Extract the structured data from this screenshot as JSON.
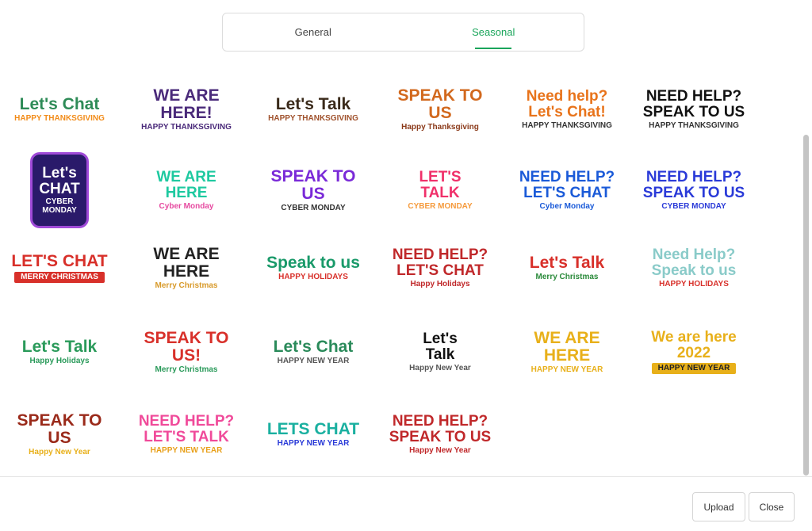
{
  "tabs": [
    {
      "label": "General"
    },
    {
      "label": "Seasonal"
    }
  ],
  "stickers": [
    {
      "l1": "Let's Chat",
      "l2": "",
      "l3": "HAPPY THANKSGIVING",
      "c1": "#2e8b57",
      "c3": "#f28c1a"
    },
    {
      "l1": "WE ARE HERE!",
      "l2": "",
      "l3": "HAPPY THANKSGIVING",
      "c1": "#4a2a7a",
      "c3": "#4a2a7a"
    },
    {
      "l1": "Let's Talk",
      "l2": "",
      "l3": "HAPPY THANKSGIVING",
      "c1": "#3a2a1a",
      "c3": "#a0522d"
    },
    {
      "l1": "SPEAK TO US",
      "l2": "",
      "l3": "Happy Thanksgiving",
      "c1": "#d2691e",
      "c3": "#8b3a1a"
    },
    {
      "l1": "Need help?",
      "l2": "Let's Chat!",
      "l3": "HAPPY THANKSGIVING",
      "c1": "#e8731a",
      "c3": "#333333"
    },
    {
      "l1": "NEED HELP?",
      "l2": "SPEAK TO US",
      "l3": "HAPPY THANKSGIVING",
      "c1": "#111111",
      "c3": "#333333"
    },
    {
      "l1": "Let's",
      "l2": "CHAT",
      "l3": "CYBER MONDAY",
      "c1": "#ffffff",
      "c3": "#ffffff"
    },
    {
      "l1": "WE ARE",
      "l2": "HERE",
      "l3": "Cyber Monday",
      "c1": "#1ec9a0",
      "c3": "#e64aa0"
    },
    {
      "l1": "SPEAK TO US",
      "l2": "",
      "l3": "CYBER MONDAY",
      "c1": "#7a2ad8",
      "c3": "#333333"
    },
    {
      "l1": "LET'S",
      "l2": "TALK",
      "l3": "CYBER MONDAY",
      "c1": "#f0306a",
      "c3": "#f59a3c"
    },
    {
      "l1": "NEED HELP?",
      "l2": "LET'S CHAT",
      "l3": "Cyber Monday",
      "c1": "#1a5ad8",
      "c3": "#1a5ad8"
    },
    {
      "l1": "NEED HELP?",
      "l2": "SPEAK TO US",
      "l3": "CYBER MONDAY",
      "c1": "#2a3ad8",
      "c3": "#2a3ad8"
    },
    {
      "l1": "LET'S CHAT",
      "l2": "",
      "l3": "MERRY CHRISTMAS",
      "c1": "#d8302a",
      "c3": "#ffffff"
    },
    {
      "l1": "WE ARE HERE",
      "l2": "",
      "l3": "Merry Christmas",
      "c1": "#222222",
      "c3": "#d89a2a"
    },
    {
      "l1": "Speak to us",
      "l2": "",
      "l3": "HAPPY HOLIDAYS",
      "c1": "#1a9a6a",
      "c3": "#d8302a"
    },
    {
      "l1": "NEED HELP?",
      "l2": "LET'S CHAT",
      "l3": "Happy Holidays",
      "c1": "#c0282a",
      "c3": "#c0282a"
    },
    {
      "l1": "Let's Talk",
      "l2": "",
      "l3": "Merry Christmas",
      "c1": "#d8302a",
      "c3": "#2a8a3a"
    },
    {
      "l1": "Need Help?",
      "l2": "Speak to us",
      "l3": "HAPPY HOLIDAYS",
      "c1": "#8acbc9",
      "c3": "#d8302a"
    },
    {
      "l1": "Let's Talk",
      "l2": "",
      "l3": "Happy Holidays",
      "c1": "#2a9a5a",
      "c3": "#2a9a5a"
    },
    {
      "l1": "SPEAK TO US!",
      "l2": "",
      "l3": "Merry Christmas",
      "c1": "#d8302a",
      "c3": "#2a9a5a"
    },
    {
      "l1": "Let's Chat",
      "l2": "",
      "l3": "HAPPY NEW YEAR",
      "c1": "#2a8a5a",
      "c3": "#555555"
    },
    {
      "l1": "Let's",
      "l2": "Talk",
      "l3": "Happy New Year",
      "c1": "#111111",
      "c3": "#555555"
    },
    {
      "l1": "WE ARE HERE",
      "l2": "",
      "l3": "HAPPY NEW YEAR",
      "c1": "#e8b01a",
      "c3": "#e8b01a"
    },
    {
      "l1": "We are here",
      "l2": "2022",
      "l3": "HAPPY NEW YEAR",
      "c1": "#e8b01a",
      "c3": "#222222"
    },
    {
      "l1": "SPEAK TO US",
      "l2": "",
      "l3": "Happy New Year",
      "c1": "#9a2a1a",
      "c3": "#e8b01a"
    },
    {
      "l1": "NEED HELP?",
      "l2": "LET'S TALK",
      "l3": "HAPPY NEW YEAR",
      "c1": "#f04a9a",
      "c3": "#e8a01a"
    },
    {
      "l1": "LETS CHAT",
      "l2": "",
      "l3": "HAPPY NEW YEAR",
      "c1": "#1ab0a0",
      "c3": "#2a3ad8"
    },
    {
      "l1": "NEED HELP?",
      "l2": "SPEAK TO US",
      "l3": "Happy New Year",
      "c1": "#c0282a",
      "c3": "#c0282a"
    }
  ],
  "footer": {
    "upload_label": "Upload",
    "close_label": "Close"
  }
}
